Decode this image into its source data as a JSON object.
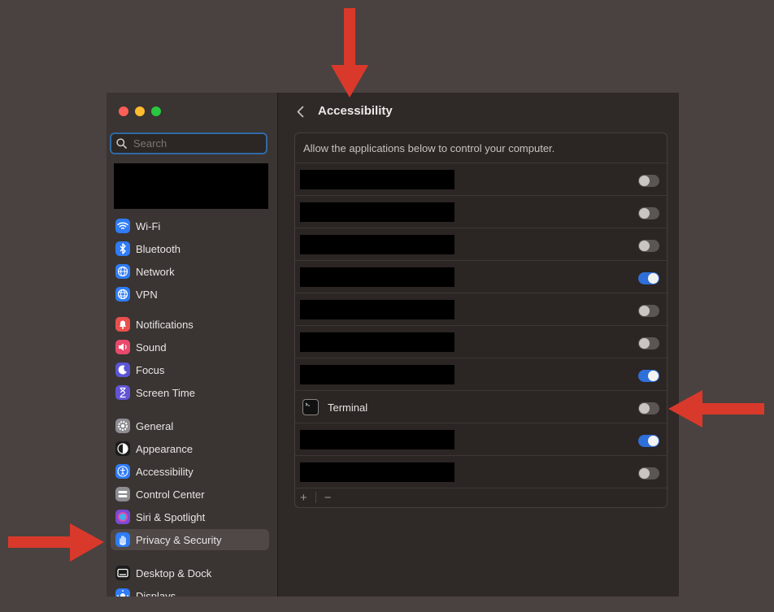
{
  "sidebar": {
    "search_placeholder": "Search",
    "groups": [
      [
        {
          "label": "Wi-Fi",
          "icon": "wifi-icon",
          "color": "#2f7cf6"
        },
        {
          "label": "Bluetooth",
          "icon": "bluetooth-icon",
          "color": "#2f7cf6"
        },
        {
          "label": "Network",
          "icon": "network-globe-icon",
          "color": "#2f7cf6"
        },
        {
          "label": "VPN",
          "icon": "vpn-globe-icon",
          "color": "#2f7cf6"
        }
      ],
      [
        {
          "label": "Notifications",
          "icon": "bell-icon",
          "color": "#e9504d"
        },
        {
          "label": "Sound",
          "icon": "speaker-icon",
          "color": "#e9496c"
        },
        {
          "label": "Focus",
          "icon": "moon-icon",
          "color": "#5b55d6"
        },
        {
          "label": "Screen Time",
          "icon": "hourglass-icon",
          "color": "#6254d6"
        }
      ],
      [
        {
          "label": "General",
          "icon": "gear-icon",
          "color": "#8d8d92"
        },
        {
          "label": "Appearance",
          "icon": "appearance-icon",
          "color": "#1c1c1c"
        },
        {
          "label": "Accessibility",
          "icon": "accessibility-icon",
          "color": "#2f7cf6"
        },
        {
          "label": "Control Center",
          "icon": "control-center-icon",
          "color": "#8d8d92"
        },
        {
          "label": "Siri & Spotlight",
          "icon": "siri-icon",
          "color": "#7a4bd6"
        },
        {
          "label": "Privacy & Security",
          "icon": "hand-icon",
          "color": "#2f7cf6",
          "selected": true
        }
      ],
      [
        {
          "label": "Desktop & Dock",
          "icon": "dock-icon",
          "color": "#1c1c1c"
        },
        {
          "label": "Displays",
          "icon": "displays-icon",
          "color": "#2f7cf6"
        }
      ]
    ]
  },
  "main": {
    "title": "Accessibility",
    "description": "Allow the applications below to control your computer.",
    "apps": [
      {
        "name": "",
        "redacted": true,
        "enabled": false
      },
      {
        "name": "",
        "redacted": true,
        "enabled": false
      },
      {
        "name": "",
        "redacted": true,
        "enabled": false
      },
      {
        "name": "",
        "redacted": true,
        "enabled": true
      },
      {
        "name": "",
        "redacted": true,
        "enabled": false
      },
      {
        "name": "",
        "redacted": true,
        "enabled": false
      },
      {
        "name": "",
        "redacted": true,
        "enabled": true
      },
      {
        "name": "Terminal",
        "redacted": false,
        "enabled": false
      },
      {
        "name": "",
        "redacted": true,
        "enabled": true
      },
      {
        "name": "",
        "redacted": true,
        "enabled": false
      }
    ],
    "footer": {
      "add": "+",
      "remove": "−"
    }
  },
  "annotations": {
    "arrow_color": "#d9392b"
  }
}
